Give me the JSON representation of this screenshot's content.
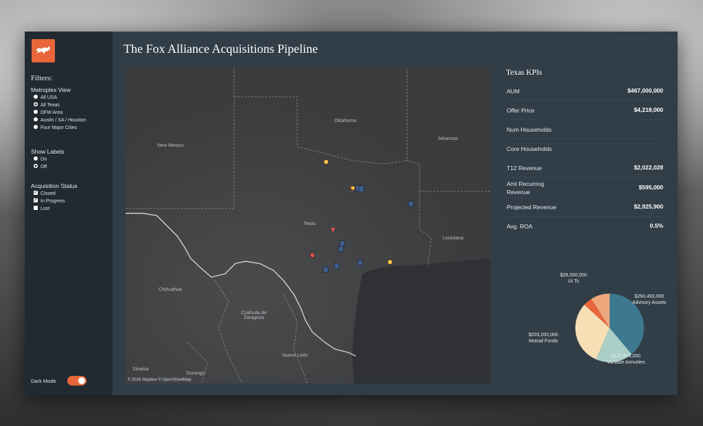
{
  "page_title": "The Fox Alliance Acquisitions Pipeline",
  "colors": {
    "accent": "#e8663a",
    "sidebar": "#222a31",
    "panel": "#313d47",
    "marker_yellow": "#f5c04a",
    "marker_red": "#e0524a",
    "marker_blue": "#3f5f8f"
  },
  "sidebar": {
    "logo_icon": "fox-logo-icon",
    "filters_title": "Filters:",
    "metroplex": {
      "title": "Metroplex View",
      "options": [
        "All USA",
        "All Texas",
        "DFW Area",
        "Austin / SA / Houston",
        "Four Major Cities"
      ],
      "selected": "All Texas"
    },
    "labels": {
      "title": "Show Labels",
      "options": [
        "On",
        "Off"
      ],
      "selected": "Off"
    },
    "status": {
      "title": "Acquisition Status",
      "options": [
        {
          "label": "Closed",
          "checked": true
        },
        {
          "label": "In Progress",
          "checked": true
        },
        {
          "label": "Lost",
          "checked": false
        }
      ]
    },
    "dark_mode_label": "Dark Mode",
    "dark_mode_on": true
  },
  "map": {
    "labels": {
      "oklahoma": "Oklahoma",
      "new_mexico": "New Mexico",
      "arkansas": "Arkansas",
      "texas": "Texas",
      "louisiana": "Louisiana",
      "chihuahua": "Chihuahua",
      "coahuila": "Coahuila de\nZaragoza",
      "nuevo_leon": "Nuevo León",
      "sinaloa": "Sinaloa",
      "durango": "Durango"
    },
    "attribution": "© 2026 Mapbox  © OpenStreetMap"
  },
  "kpis": {
    "title": "Texas KPIs",
    "items": [
      {
        "label": "AUM",
        "value": "$467,000,000"
      },
      {
        "label": "Offer Price",
        "value": "$4,218,000"
      },
      {
        "label": "Num Households",
        "value": ""
      },
      {
        "label": "Core Households",
        "value": ""
      },
      {
        "label": "T12 Revenue",
        "value": "$2,022,028"
      },
      {
        "label": "Amt Recurring Revenue",
        "value": "$595,000"
      },
      {
        "label": "Projected Revenue",
        "value": "$2,925,900"
      },
      {
        "label": "Avg. ROA",
        "value": "0.5%"
      }
    ]
  },
  "chart_data": {
    "type": "pie",
    "slices": [
      {
        "label": "Advisory Assets",
        "value": 260493000,
        "display": "$260,493,000",
        "color": "#3d7891"
      },
      {
        "label": "Variable Annuities",
        "value": 117674000,
        "display": "$117,674,000",
        "color": "#a9cfc7"
      },
      {
        "label": "Mutual Funds",
        "value": 203200000,
        "display": "$203,200,000",
        "color": "#f6dfb5"
      },
      {
        "label": "UI Ts",
        "value": 28000000,
        "display": "$28,000,000",
        "color": "#e8663a"
      },
      {
        "label": "",
        "value": 60000000,
        "display": "",
        "color": "#eea77c"
      }
    ]
  }
}
